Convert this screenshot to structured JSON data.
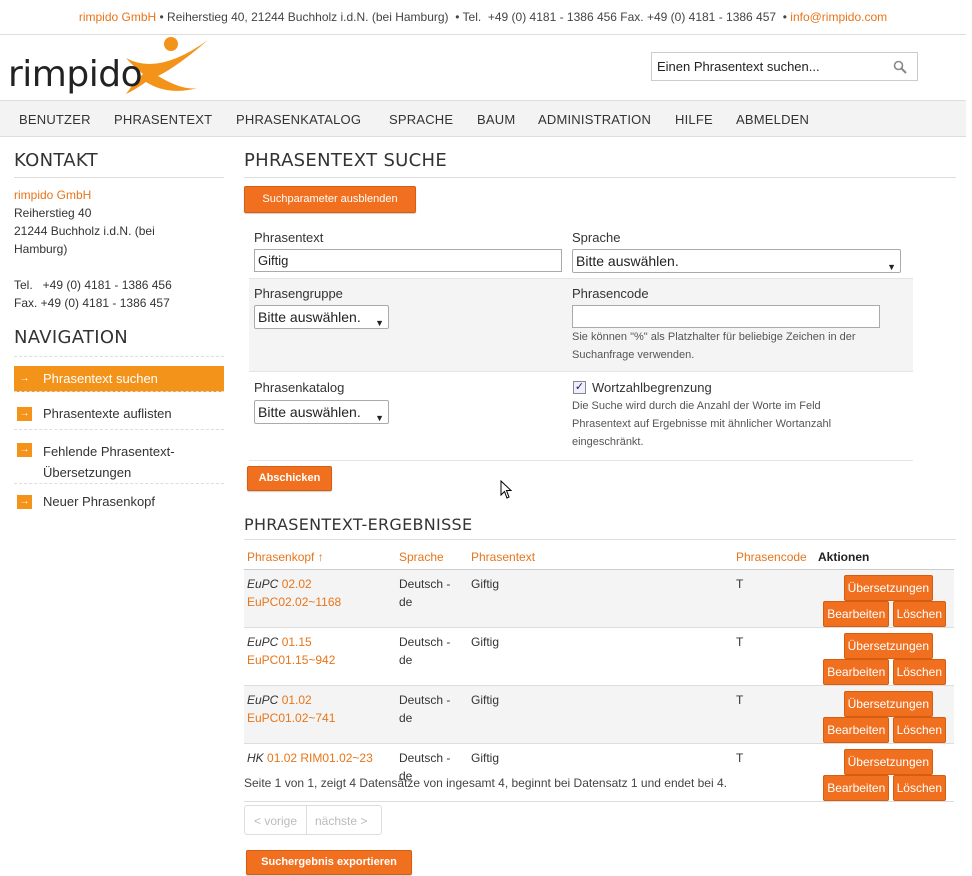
{
  "topbar": {
    "company": "rimpido GmbH",
    "address": " • Reiherstieg 40, 21244 Buchholz i.d.N. (bei Hamburg)  • Tel.  +49 (0) 4181 - 1386 456 Fax. +49 (0) 4181 - 1386 457  • ",
    "email": "info@rimpido.com"
  },
  "logo": {
    "text": "rimpido"
  },
  "search": {
    "placeholder": "Einen Phrasentext suchen..."
  },
  "menu": [
    "BENUTZER",
    "PHRASENTEXT",
    "PHRASENKATALOG",
    "SPRACHE",
    "BAUM",
    "ADMINISTRATION",
    "HILFE",
    "ABMELDEN"
  ],
  "sidebar": {
    "contact_title": "KONTAKT",
    "company": "rimpido GmbH",
    "street": "Reiherstieg 40",
    "city": "21244 Buchholz i.d.N. (bei",
    "city2": "Hamburg)",
    "tel": "Tel.   +49 (0) 4181 - 1386 456",
    "fax": "Fax. +49 (0) 4181 - 1386 457",
    "nav_title": "NAVIGATION",
    "nav_items": [
      "Phrasentext suchen",
      "Phrasentexte auflisten",
      "Fehlende Phrasentext-",
      "Übersetzungen",
      "Neuer Phrasenkopf"
    ]
  },
  "search_form": {
    "title": "PHRASENTEXT SUCHE",
    "toggle_button": "Suchparameter ausblenden",
    "phrasentext_label": "Phrasentext",
    "phrasentext_value": "Giftig",
    "sprache_label": "Sprache",
    "sprache_value": "Bitte auswählen.",
    "phrasengruppe_label": "Phrasengruppe",
    "phrasengruppe_value": "Bitte auswählen.",
    "phrasencode_label": "Phrasencode",
    "phrasencode_hint1": "Sie können \"%\" als Platzhalter für beliebige Zeichen in der",
    "phrasencode_hint2": "Suchanfrage verwenden.",
    "phrasenkatalog_label": "Phrasenkatalog",
    "phrasenkatalog_value": "Bitte auswählen.",
    "wortzahl_label": "Wortzahlbegrenzung",
    "wortzahl_checked": true,
    "wortzahl_hint1": "Die Suche wird durch die Anzahl der Worte im Feld",
    "wortzahl_hint2": "Phrasentext auf Ergebnisse mit ähnlicher Wortanzahl",
    "wortzahl_hint3": "eingeschränkt.",
    "submit_button": "Abschicken"
  },
  "results": {
    "title": "PHRASENTEXT-ERGEBNISSE",
    "columns": [
      "Phrasenkopf ↑",
      "Sprache",
      "Phrasentext",
      "Phrasencode",
      "Aktionen"
    ],
    "rows": [
      {
        "prefix": "EuPC",
        "code": "02.02",
        "key": "EuPC02.02~1168",
        "lang1": "Deutsch -",
        "lang2": "de",
        "text": "Giftig",
        "pcode": "T"
      },
      {
        "prefix": "EuPC",
        "code": "01.15",
        "key": "EuPC01.15~942",
        "lang1": "Deutsch -",
        "lang2": "de",
        "text": "Giftig",
        "pcode": "T"
      },
      {
        "prefix": "EuPC",
        "code": "01.02",
        "key": "EuPC01.02~741",
        "lang1": "Deutsch -",
        "lang2": "de",
        "text": "Giftig",
        "pcode": "T"
      },
      {
        "prefix": "HK",
        "code": "01.02",
        "key": "RIM01.02~23",
        "lang1": "Deutsch -",
        "lang2": "de",
        "text": "Giftig",
        "pcode": "T"
      }
    ],
    "btn_translate": "Übersetzungen",
    "btn_edit": "Bearbeiten",
    "btn_delete": "Löschen",
    "summary": "Seite 1 von 1, zeigt 4 Datensätze von ingesamt 4, beginnt bei Datensatz 1 und endet bei 4.",
    "prev": "< vorige",
    "next": "nächste >",
    "export_button": "Suchergebnis exportieren"
  },
  "colors": {
    "accent": "#f07020",
    "nav_active": "#f39319"
  }
}
